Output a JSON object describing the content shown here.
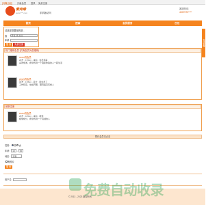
{
  "topbar": {
    "items": [
      "[马鞍山站]",
      "升级会员",
      "登录",
      "免费注册"
    ]
  },
  "header": {
    "logo_text": "爱尚缘",
    "logo_sub": "www.***.com",
    "link": "手机版访问",
    "hotline_label": "客服热线",
    "hotline": "4007070****"
  },
  "nav": {
    "items": [
      "首页",
      "搜索",
      "会员服务",
      "日记"
    ]
  },
  "search": {
    "title": "请选择您要找的是...",
    "gender_label": "我",
    "gender_value": "男性 找 女性",
    "age_label": "年龄",
    "age_value": "",
    "search_btn": "搜 索",
    "register_btn": "免费注册"
  },
  "sidebar_tab": "在线客服",
  "list": {
    "header": "热门推荐会员 (共有会员为您推荐)",
    "people": [
      {
        "name": "xxxxx的会员",
        "info1": "29岁 · 170cm · 本科 · 会员年薪",
        "info2": "喜欢旅游，希望找到一个温柔体贴的人一起生活"
      },
      {
        "name": "yyyyy的会员",
        "info1": "33岁 · 178cm · 硕士 · 国企员工",
        "info2": "工作稳定，性格开朗，期待遇见有缘人"
      }
    ]
  },
  "second": {
    "header": "最新注册",
    "person": {
      "name": "zzzzz的会员",
      "info1": "28岁 · 165cm · 本科 · 教师",
      "info2": "相信缘分，希望找到一个真诚的人"
    }
  },
  "bar_center": "预约会员请点击",
  "form": {
    "gender_label": "性别:",
    "opt_male": "男",
    "opt_female": "女",
    "age_label": "年龄:",
    "age_from": "18",
    "age_to": "35",
    "city_label": "地区:",
    "city_value": "不限",
    "photo_label": "有照片",
    "search_btn": "搜 索"
  },
  "comment": {
    "label": "用户名:",
    "value": ""
  },
  "footer": {
    "text": "© 2013 - 2023 版权所有"
  },
  "watermark": {
    "text": "免费自动收录"
  }
}
